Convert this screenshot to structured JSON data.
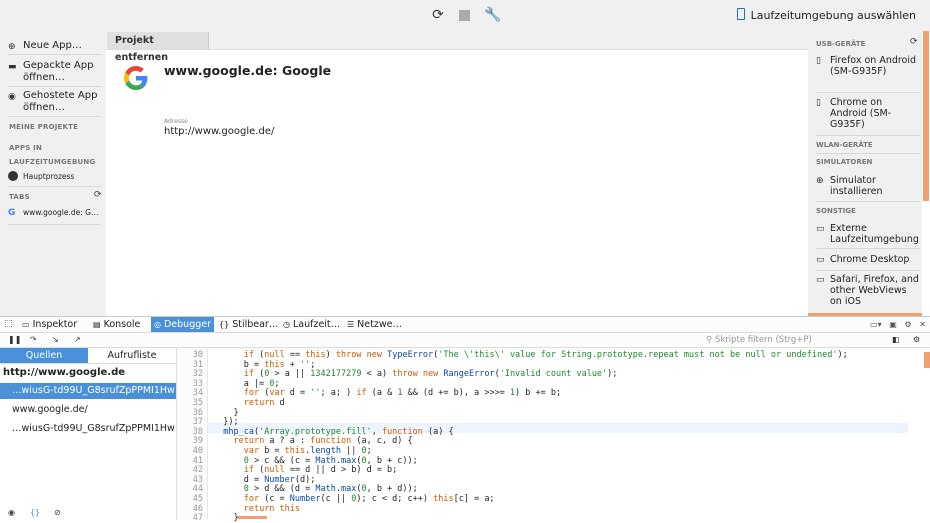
{
  "topbar": {
    "runtime_label": "Laufzeitumgebung auswählen"
  },
  "left": {
    "new_app": "Neue App…",
    "packaged_app": "Gepackte App öffnen…",
    "hosted_app": "Gehostete App öffnen…",
    "my_projects": "MEINE PROJEKTE",
    "apps_in_runtime": "APPS IN LAUFZEITUMGEBUNG",
    "main_process": "Hauptprozess",
    "tabs": "TABS",
    "tab_google": "www.google.de: G…"
  },
  "center": {
    "tab_remove": "Projekt entfernen",
    "app_title": "www.google.de: Google",
    "address_label": "Adresse",
    "address_value": "http://www.google.de/"
  },
  "right": {
    "usb_devices": "USB-GERÄTE",
    "firefox_android": "Firefox on Android (SM-G935F)",
    "chrome_android": "Chrome on Android (SM-G935F)",
    "wlan_devices": "WLAN-GERÄTE",
    "simulators": "SIMULATOREN",
    "install_sim": "Simulator installieren",
    "other": "SONSTIGE",
    "external_runtime": "Externe Laufzeitumgebung",
    "chrome_desktop": "Chrome Desktop",
    "safari": "Safari, Firefox, and other WebViews on iOS"
  },
  "devtools": {
    "tabs": [
      "Inspektor",
      "Konsole",
      "Debugger",
      "Stilbear…",
      "Laufzeit…",
      "Netzwe…"
    ],
    "filter_placeholder": "Skripte filtern (Strg+P)",
    "sources_tab": "Quellen",
    "callstack_tab": "Aufrufliste",
    "root": "http://www.google.de",
    "items": [
      "…wiusG-td99U_G8srufZpPPMI1Hw",
      "www.google.de/",
      "…wiusG-td99U_G8srufZpPPMI1Hw"
    ]
  },
  "code": {
    "lines": [
      "30",
      "31",
      "32",
      "33",
      "34",
      "35",
      "36",
      "37",
      "38",
      "39",
      "40",
      "41",
      "42",
      "43",
      "44",
      "45",
      "46",
      "47"
    ]
  }
}
